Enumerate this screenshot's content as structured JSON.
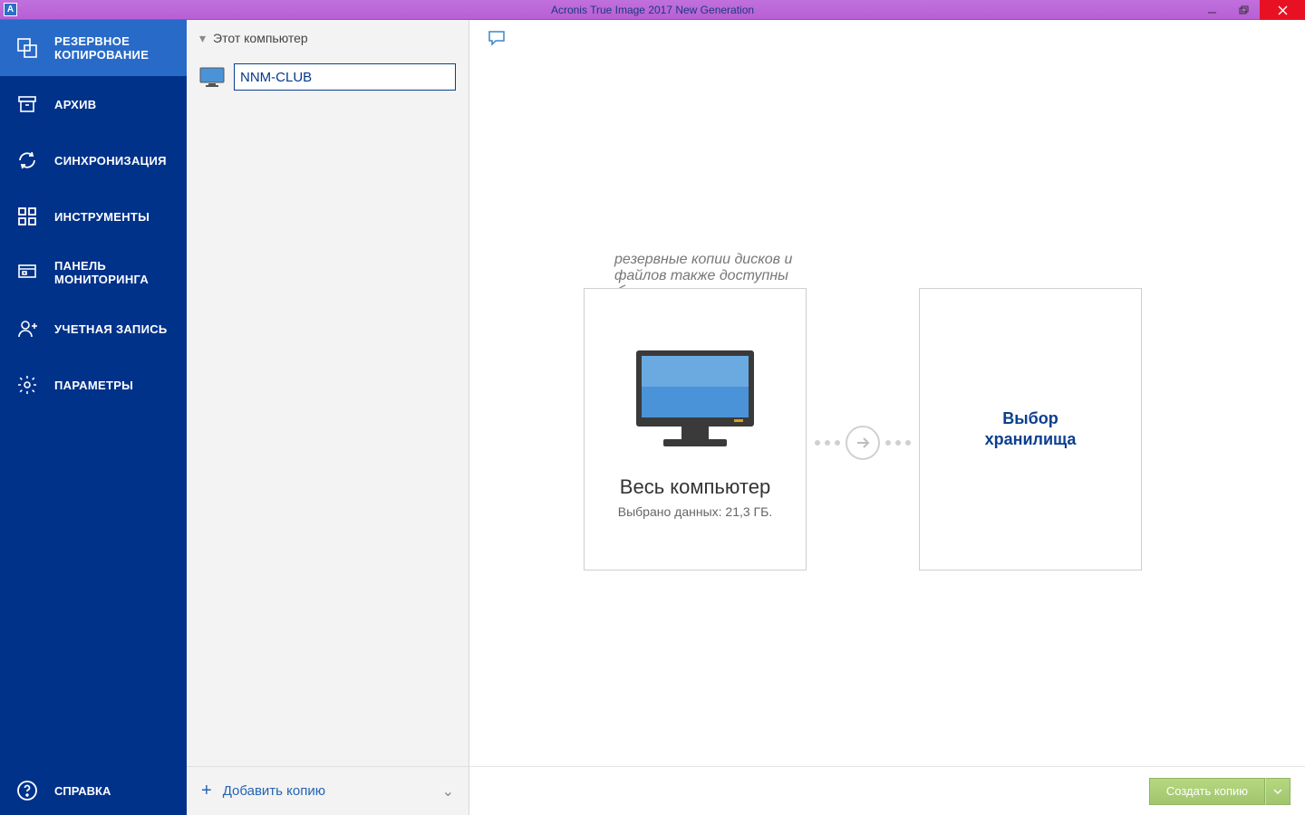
{
  "window": {
    "title": "Acronis True Image 2017 New Generation",
    "icon_letter": "A"
  },
  "nav": {
    "items": [
      {
        "label": "РЕЗЕРВНОЕ КОПИРОВАНИЕ",
        "icon": "backup-icon",
        "active": true
      },
      {
        "label": "АРХИВ",
        "icon": "archive-icon",
        "active": false
      },
      {
        "label": "СИНХРОНИЗАЦИЯ",
        "icon": "sync-icon",
        "active": false
      },
      {
        "label": "ИНСТРУМЕНТЫ",
        "icon": "tools-icon",
        "active": false
      },
      {
        "label": "ПАНЕЛЬ МОНИТОРИНГА",
        "icon": "dashboard-icon",
        "active": false
      },
      {
        "label": "УЧЕТНАЯ ЗАПИСЬ",
        "icon": "account-icon",
        "active": false
      },
      {
        "label": "ПАРАМЕТРЫ",
        "icon": "settings-icon",
        "active": false
      }
    ],
    "help_label": "СПРАВКА"
  },
  "list": {
    "header": "Этот компьютер",
    "item_value": "NNM-CLUB",
    "add_label": "Добавить копию"
  },
  "stage": {
    "hint_line1": "резервные копии дисков и",
    "hint_line2": "файлов также доступны",
    "source_title": "Весь компьютер",
    "source_sub": "Выбрано данных: 21,3 ГБ.",
    "dest_line1": "Выбор",
    "dest_line2": "хранилища"
  },
  "footer": {
    "run_label": "Создать копию"
  },
  "colors": {
    "nav_bg": "#00328a",
    "nav_active": "#286ac8",
    "accent_blue": "#0b3f8e",
    "btn_green": "#8fc04a"
  }
}
